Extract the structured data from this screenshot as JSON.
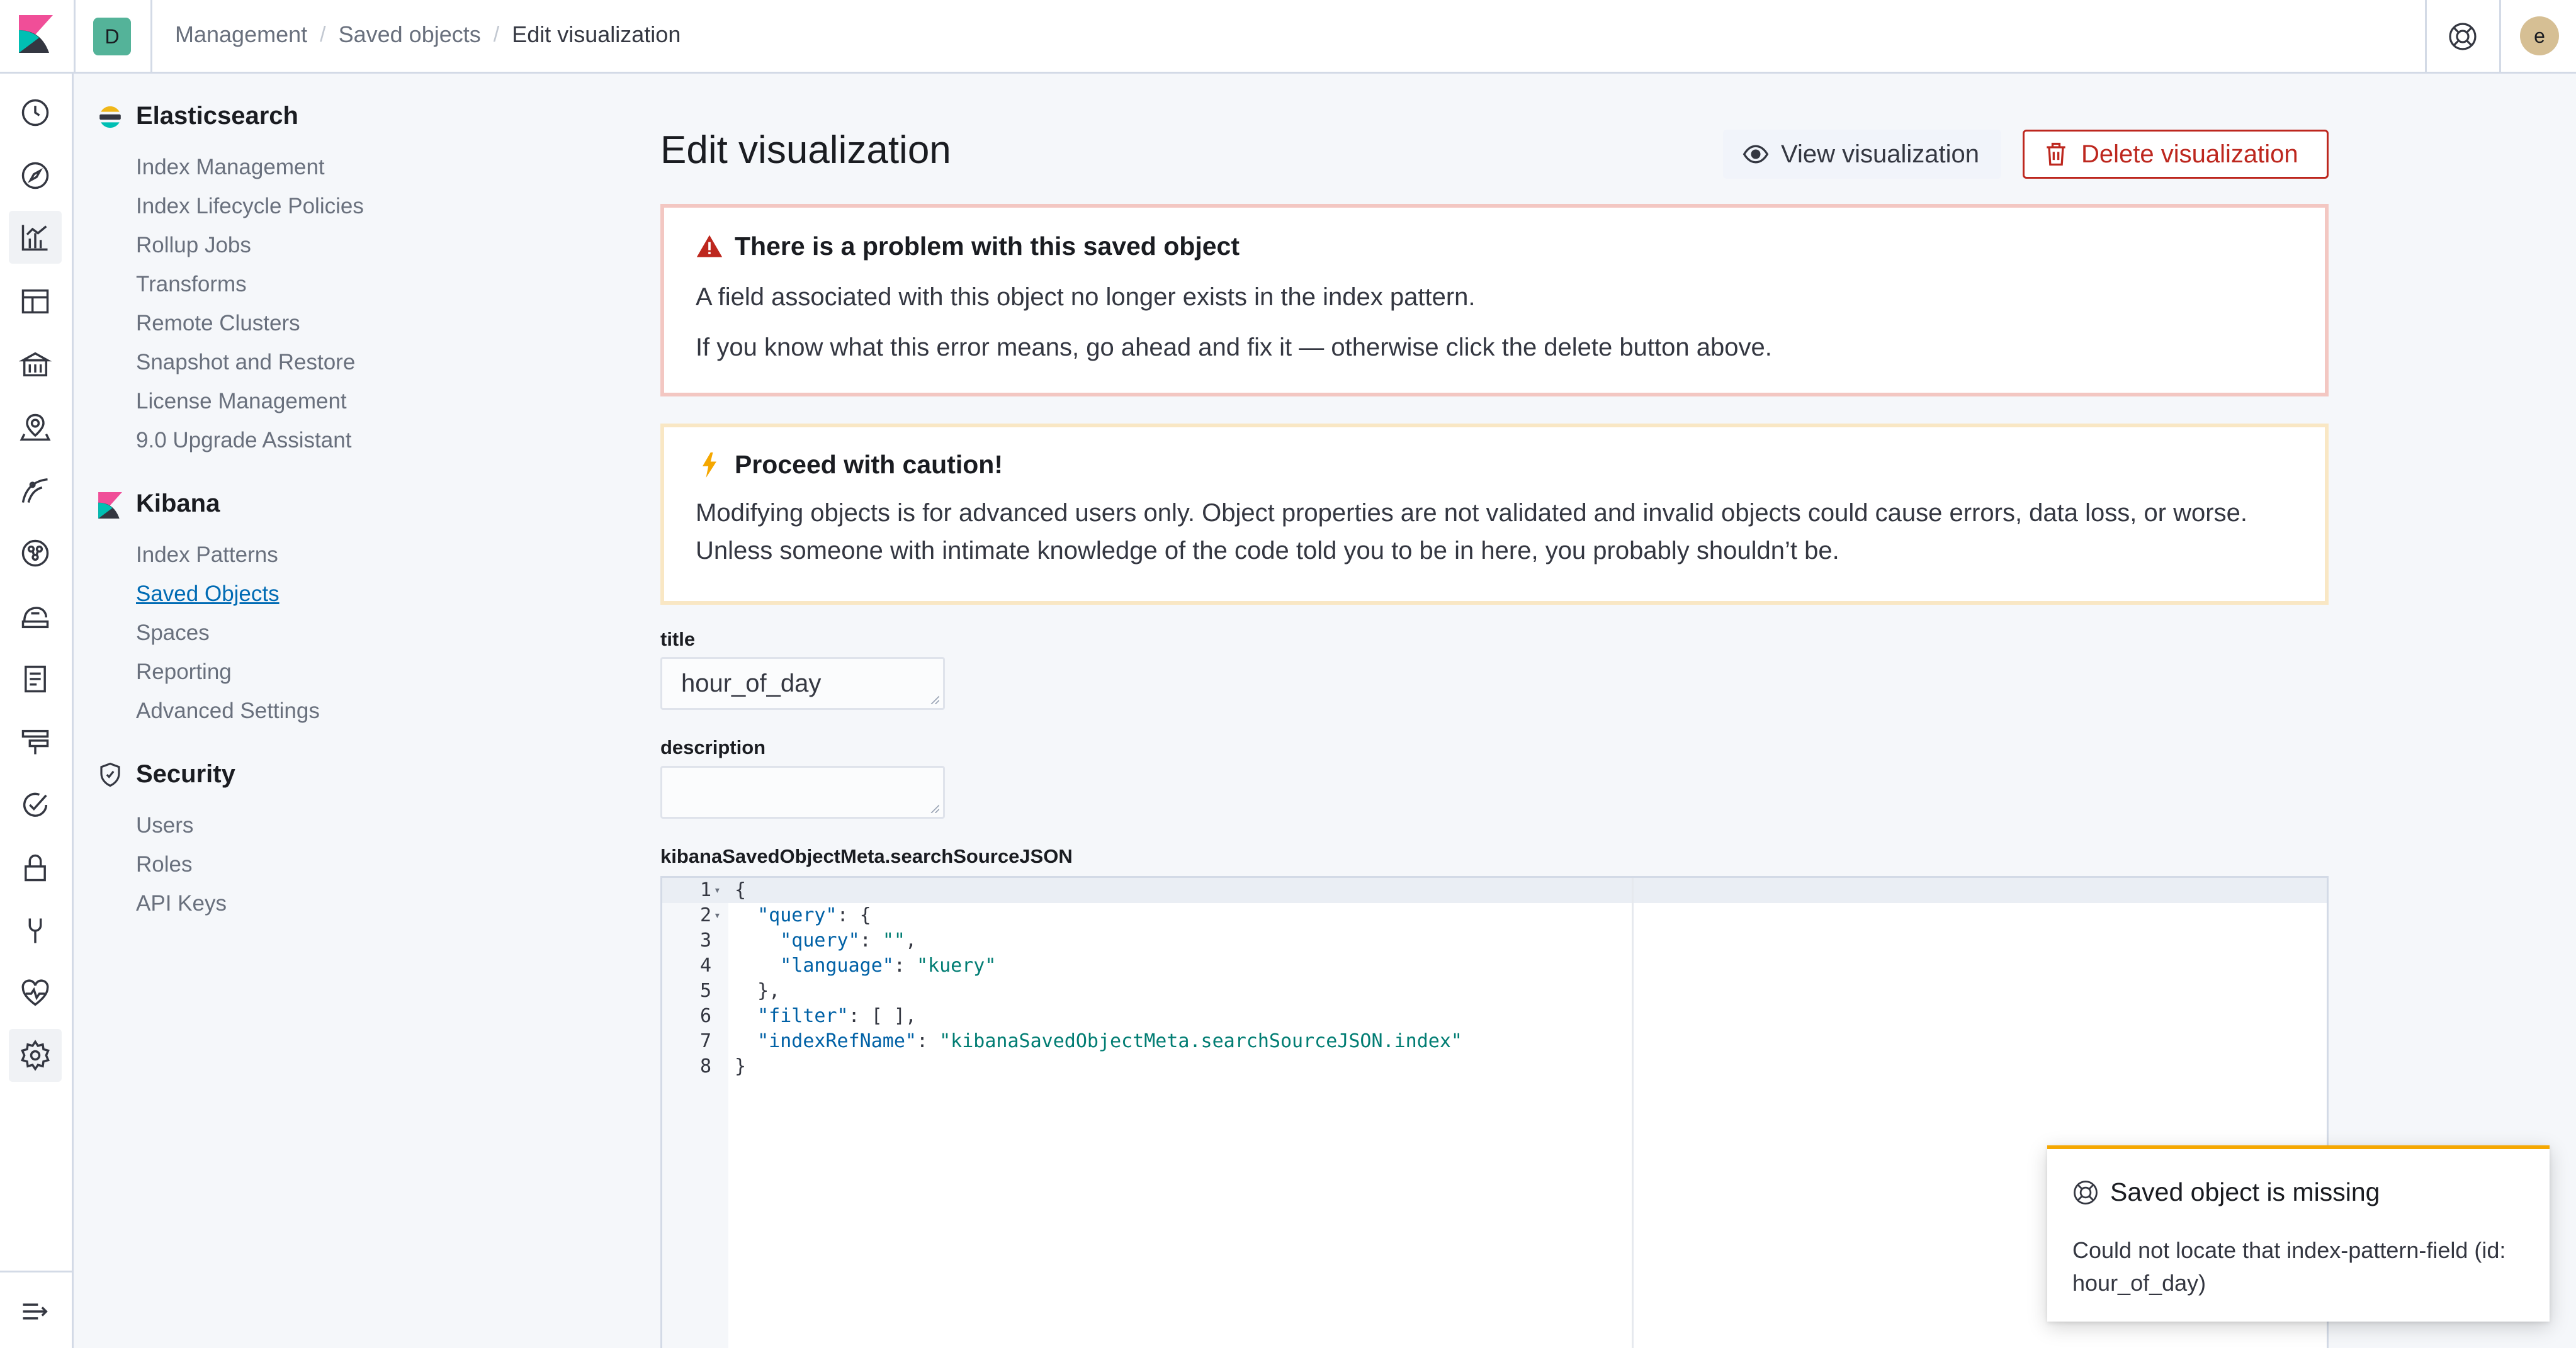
{
  "header": {
    "space_initial": "D",
    "user_initial": "e",
    "breadcrumbs": [
      "Management",
      "Saved objects",
      "Edit visualization"
    ]
  },
  "sidebar": {
    "sections": [
      {
        "title": "Elasticsearch",
        "icon": "elasticsearch-logo-icon",
        "items": [
          "Index Management",
          "Index Lifecycle Policies",
          "Rollup Jobs",
          "Transforms",
          "Remote Clusters",
          "Snapshot and Restore",
          "License Management",
          "9.0 Upgrade Assistant"
        ]
      },
      {
        "title": "Kibana",
        "icon": "kibana-logo-icon",
        "items": [
          "Index Patterns",
          "Saved Objects",
          "Spaces",
          "Reporting",
          "Advanced Settings"
        ]
      },
      {
        "title": "Security",
        "icon": "shield-icon",
        "items": [
          "Users",
          "Roles",
          "API Keys"
        ]
      }
    ],
    "selected_item": "Saved Objects"
  },
  "nav_rail": {
    "icons": [
      "clock-icon",
      "discover-compass-icon",
      "visualize-icon",
      "dashboard-icon",
      "canvas-icon",
      "maps-icon",
      "ml-icon",
      "graph-icon",
      "metrics-icon",
      "logs-icon",
      "apm-icon",
      "uptime-icon",
      "siem-lock-icon",
      "dev-tools-icon",
      "monitoring-icon",
      "management-gear-icon"
    ],
    "active_icon": "management-gear-icon",
    "collapse_icon": "menu-collapse-icon"
  },
  "main": {
    "title": "Edit visualization",
    "view_button_label": "View visualization",
    "delete_button_label": "Delete visualization",
    "error_callout": {
      "title": "There is a problem with this saved object",
      "lines": [
        "A field associated with this object no longer exists in the index pattern.",
        "If you know what this error means, go ahead and fix it — otherwise click the delete button above."
      ]
    },
    "warning_callout": {
      "title": "Proceed with caution!",
      "text": "Modifying objects is for advanced users only. Object properties are not validated and invalid objects could cause errors, data loss, or worse. Unless someone with intimate knowledge of the code told you to be in here, you probably shouldn’t be."
    },
    "fields": {
      "title_label": "title",
      "title_value": "hour_of_day",
      "description_label": "description",
      "description_value": "",
      "json_label": "kibanaSavedObjectMeta.searchSourceJSON"
    },
    "editor_lines": [
      {
        "n": "1",
        "fold": true,
        "html": "{"
      },
      {
        "n": "2",
        "fold": true,
        "html": "  <span class='k'>\"query\"</span>: {"
      },
      {
        "n": "3",
        "fold": false,
        "html": "    <span class='k'>\"query\"</span>: <span class='s'>\"\"</span>,"
      },
      {
        "n": "4",
        "fold": false,
        "html": "    <span class='k'>\"language\"</span>: <span class='s'>\"kuery\"</span>"
      },
      {
        "n": "5",
        "fold": false,
        "html": "  },"
      },
      {
        "n": "6",
        "fold": false,
        "html": "  <span class='k'>\"filter\"</span>: [ ],"
      },
      {
        "n": "7",
        "fold": false,
        "html": "  <span class='k'>\"indexRefName\"</span>: <span class='s'>\"kibanaSavedObjectMeta.searchSourceJSON.index\"</span>"
      },
      {
        "n": "8",
        "fold": false,
        "html": "}"
      }
    ]
  },
  "toast": {
    "title": "Saved object is missing",
    "text": "Could not locate that index-pattern-field (id: hour_of_day)"
  },
  "colors": {
    "accent": "#006bb4",
    "danger": "#bd271e",
    "warning": "#f5a700",
    "space_avatar": "#54b399",
    "user_avatar": "#d6bf94"
  }
}
